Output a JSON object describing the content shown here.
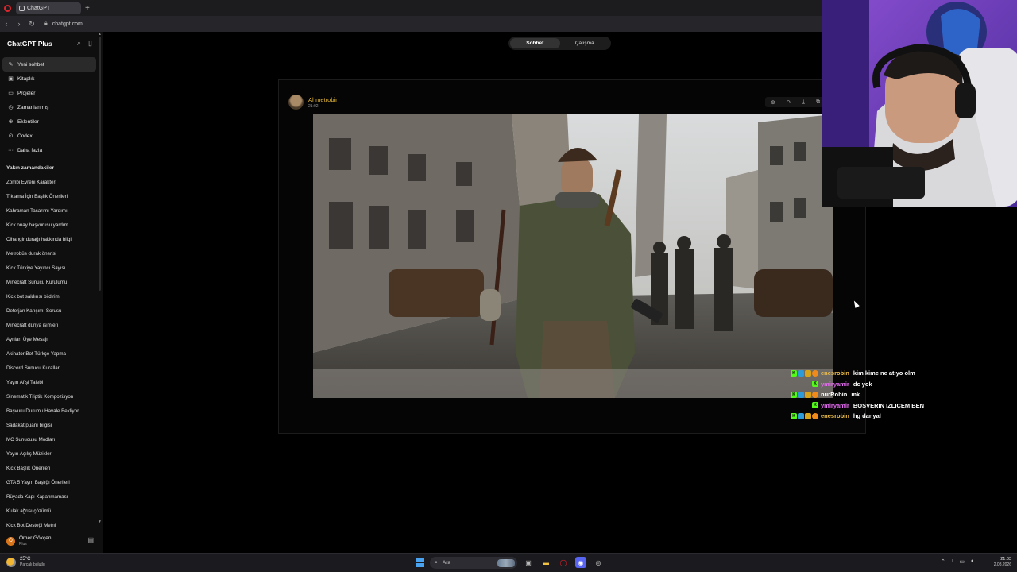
{
  "browser": {
    "tab_title": "ChatGPT",
    "new_tab": "+",
    "url": "chatgpt.com"
  },
  "sidebar": {
    "brand": "ChatGPT Plus",
    "menu": [
      {
        "icon": "edit-icon",
        "label": "Yeni sohbet",
        "active": true
      },
      {
        "icon": "library-icon",
        "label": "Kitaplık"
      },
      {
        "icon": "folder-icon",
        "label": "Projeler"
      },
      {
        "icon": "clock-icon",
        "label": "Zamanlanmış"
      },
      {
        "icon": "plugin-icon",
        "label": "Eklentiler"
      },
      {
        "icon": "codex-icon",
        "label": "Codex"
      },
      {
        "icon": "more-icon",
        "label": "Daha fazla"
      }
    ],
    "section_title": "Yakın zamandakiler",
    "history": [
      "Zombi Evreni Karakteri",
      "Tıklama İçin Başlık Önerileri",
      "Kahraman Tasarımı Yardımı",
      "Kick onay başvurusu yardım",
      "Cihangir durağı hakkında bilgi",
      "Metrobüs durak önerisi",
      "Kick Türkiye Yayıncı Sayısı",
      "Minecraft Sunucu Kurulumu",
      "Kick bot saldırısı bildirimi",
      "Deterjan Karışımı Sorusu",
      "Minecraft dünya isimleri",
      "Aynları Üye Mesajı",
      "Akinator Bot Türkçe Yapma",
      "Discord Sunucu Kuralları",
      "Yayın Afişi Talebi",
      "Sinematik Triptik Kompozisyon",
      "Başvuru Durumu Havale Bekliyor",
      "Sadakat puanı bilgisi",
      "MC Sunucusu Modları",
      "Yayın Açılış Müzikleri",
      "Kick Başlık Önerileri",
      "GTA 5 Yayın Başlığı Önerileri",
      "Rüyada Kapı Kapanmaması",
      "Kulak ağrısı çözümü",
      "Kick Bot Desteği Metni"
    ],
    "user": {
      "initial": "Ö",
      "name": "Ömer Gökçen",
      "plan": "Plus"
    }
  },
  "main": {
    "modes": [
      "Sohbet",
      "Çalışma"
    ],
    "active_mode": "Sohbet",
    "post": {
      "author": "Ahmetrobin",
      "time": "21:02"
    }
  },
  "stream_chat": [
    {
      "badges": [
        "k",
        "s",
        "g",
        "o"
      ],
      "user": "enesrobin",
      "color": "#f2c14e",
      "text": "kim kime ne atıyo olm"
    },
    {
      "badges": [
        "k"
      ],
      "user": "ymiryamir",
      "color": "#e76bf3",
      "text": "dc yok"
    },
    {
      "badges": [
        "k",
        "s",
        "g",
        "o"
      ],
      "user": "nurRobin",
      "color": "#ffffff",
      "text": "mk"
    },
    {
      "badges": [
        "k"
      ],
      "user": "ymiryamir",
      "color": "#e76bf3",
      "text": "BOSVERIN IZLICEM BEN"
    },
    {
      "badges": [
        "k",
        "s",
        "g",
        "o"
      ],
      "user": "enesrobin",
      "color": "#f2c14e",
      "text": "hg danyal"
    }
  ],
  "taskbar": {
    "weather_temp": "25°C",
    "weather_cond": "Parçalı bulutlu",
    "search_placeholder": "Ara",
    "time": "21:03",
    "date": "2.08.2026"
  }
}
